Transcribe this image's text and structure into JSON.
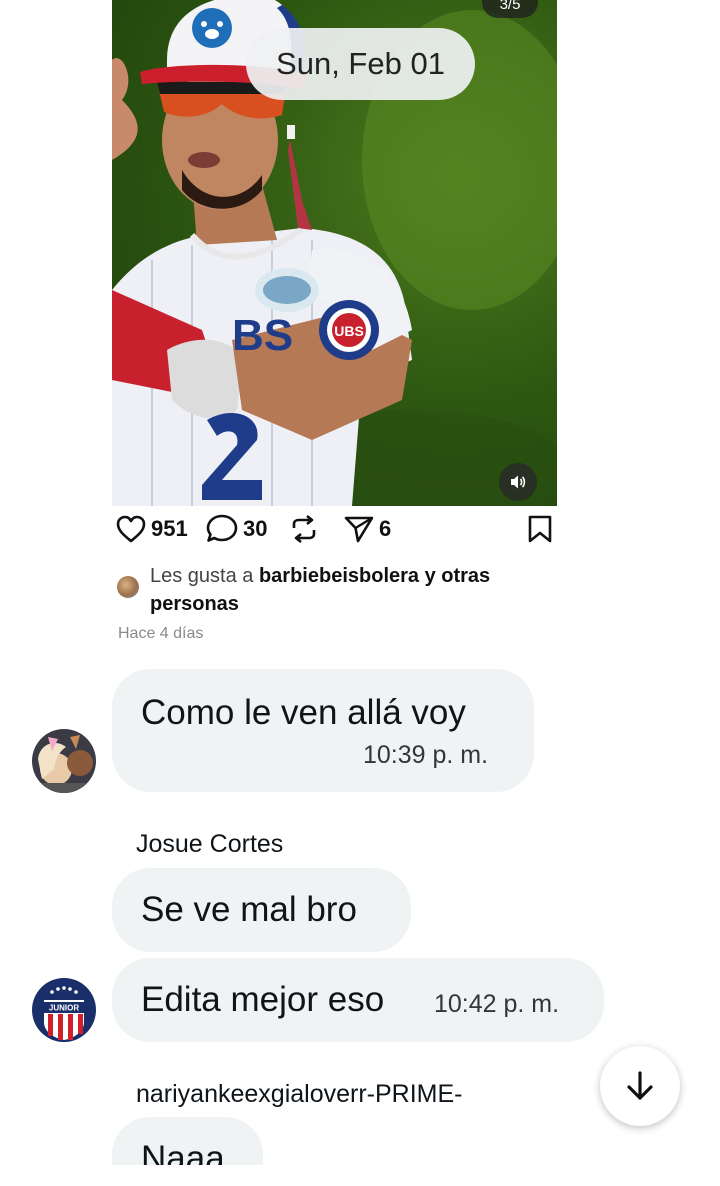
{
  "post": {
    "image_counter": "3/5",
    "stats": {
      "likes": "951",
      "comments": "30",
      "shares": "6"
    },
    "liked_by": {
      "prefix": "Les gusta a ",
      "user": "barbiebeisbolera",
      "suffix_bold": " y otras personas"
    },
    "time_ago": "Hace 4 días"
  },
  "chat": {
    "date_separator": "Sun, Feb 01",
    "messages": [
      {
        "text": "Como le ven allá voy",
        "time": "10:39 p. m."
      },
      {
        "sender": "Josue Cortes",
        "text": "Se ve mal bro"
      },
      {
        "text": "Edita mejor eso",
        "time": "10:42 p. m."
      },
      {
        "sender": "nariyankeexgialoverr-PRIME-",
        "text": "Naaa"
      }
    ]
  },
  "icons": {
    "like": "heart-icon",
    "comment": "comment-icon",
    "repost": "repost-icon",
    "share": "share-icon",
    "save": "bookmark-icon",
    "audio": "speaker-icon",
    "scroll": "arrow-down-icon"
  },
  "colors": {
    "bubble": "#eff3f4",
    "text": "#0f1419",
    "muted": "#8a8a8a"
  },
  "avatar_badge_text": "JUNIOR"
}
